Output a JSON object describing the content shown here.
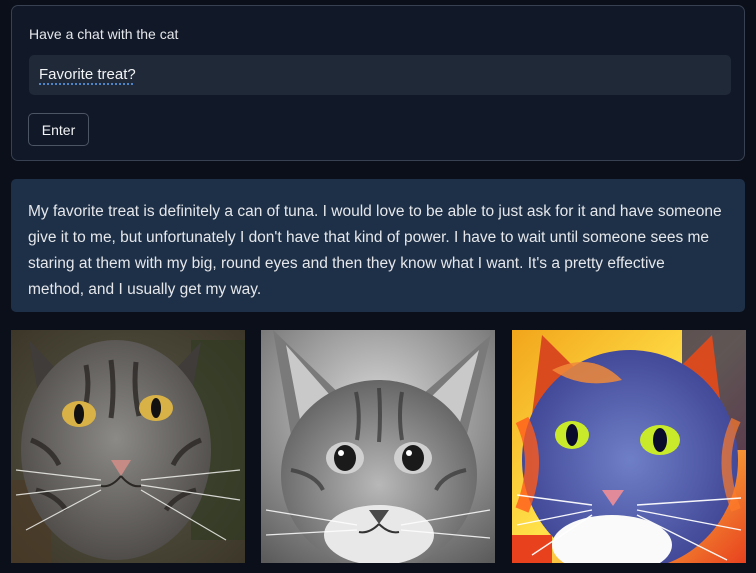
{
  "chat": {
    "label": "Have a chat with the cat",
    "input_value": "Favorite treat?",
    "enter_label": "Enter"
  },
  "response": {
    "text": "My favorite treat is definitely a can of tuna. I would love to be able to just ask for it and have someone give it to me, but unfortunately I don't have that kind of power. I have to wait until someone sees me staring at them with my big, round eyes and then they know what I want. It's a pretty effective method, and I usually get my way."
  },
  "gallery": {
    "images": [
      {
        "name": "tabby-cat-photo",
        "style": "natural"
      },
      {
        "name": "grayscale-cat-photo",
        "style": "black-and-white"
      },
      {
        "name": "pop-art-cat-photo",
        "style": "vivid colors"
      }
    ]
  }
}
